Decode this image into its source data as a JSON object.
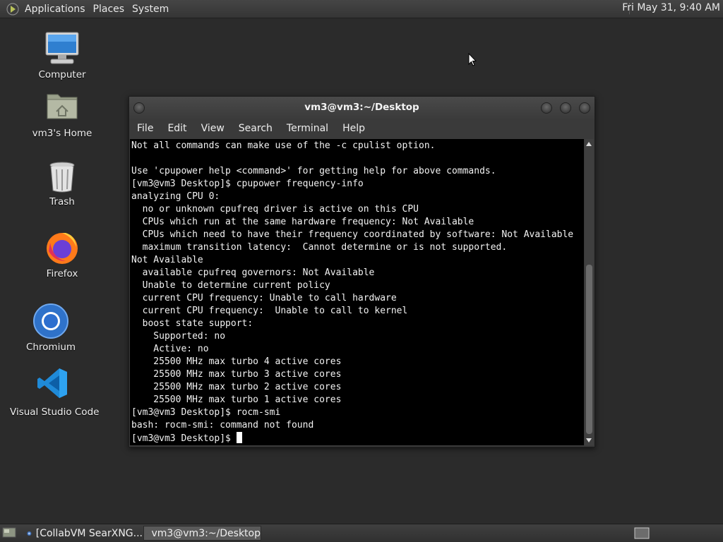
{
  "top_panel": {
    "menus": [
      "Applications",
      "Places",
      "System"
    ],
    "clock": "Fri May 31,  9:40 AM"
  },
  "desktop_icons": [
    {
      "label": "Computer",
      "icon": "computer-icon"
    },
    {
      "label": "vm3's Home",
      "icon": "home-folder-icon"
    },
    {
      "label": "Trash",
      "icon": "trash-icon"
    },
    {
      "label": "Firefox",
      "icon": "firefox-icon"
    },
    {
      "label": "Chromium",
      "icon": "chromium-icon"
    },
    {
      "label": "Visual Studio Code",
      "icon": "vscode-icon"
    }
  ],
  "terminal": {
    "title": "vm3@vm3:~/Desktop",
    "menus": [
      "File",
      "Edit",
      "View",
      "Search",
      "Terminal",
      "Help"
    ],
    "lines": [
      "Not all commands can make use of the -c cpulist option.",
      "",
      "Use 'cpupower help <command>' for getting help for above commands.",
      "[vm3@vm3 Desktop]$ cpupower frequency-info",
      "analyzing CPU 0:",
      "  no or unknown cpufreq driver is active on this CPU",
      "  CPUs which run at the same hardware frequency: Not Available",
      "  CPUs which need to have their frequency coordinated by software: Not Available",
      "  maximum transition latency:  Cannot determine or is not supported.",
      "Not Available",
      "  available cpufreq governors: Not Available",
      "  Unable to determine current policy",
      "  current CPU frequency: Unable to call hardware",
      "  current CPU frequency:  Unable to call to kernel",
      "  boost state support:",
      "    Supported: no",
      "    Active: no",
      "    25500 MHz max turbo 4 active cores",
      "    25500 MHz max turbo 3 active cores",
      "    25500 MHz max turbo 2 active cores",
      "    25500 MHz max turbo 1 active cores",
      "[vm3@vm3 Desktop]$ rocm-smi",
      "bash: rocm-smi: command not found"
    ],
    "prompt": "[vm3@vm3 Desktop]$ "
  },
  "taskbar": {
    "tasks": [
      {
        "label": "[CollabVM SearXNG...",
        "icon": "browser-icon",
        "active": false
      },
      {
        "label": "vm3@vm3:~/Desktop",
        "icon": "terminal-icon",
        "active": true
      }
    ]
  }
}
